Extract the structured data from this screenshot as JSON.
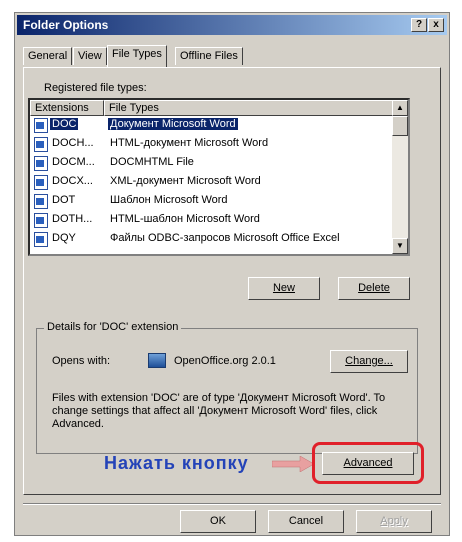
{
  "window": {
    "title": "Folder Options",
    "help_button": "?",
    "close_button": "x"
  },
  "tabs": [
    {
      "label": "General"
    },
    {
      "label": "View"
    },
    {
      "label": "File Types"
    },
    {
      "label": "Offline Files"
    }
  ],
  "registered": {
    "label": "Registered file types:",
    "columns": [
      "Extensions",
      "File Types"
    ],
    "rows": [
      {
        "ext": "DOC",
        "type": "Документ Microsoft Word"
      },
      {
        "ext": "DOCH...",
        "type": "HTML-документ Microsoft Word"
      },
      {
        "ext": "DOCM...",
        "type": "DOCMHTML File"
      },
      {
        "ext": "DOCX...",
        "type": "XML-документ Microsoft Word"
      },
      {
        "ext": "DOT",
        "type": "Шаблон Microsoft Word"
      },
      {
        "ext": "DOTH...",
        "type": "HTML-шаблон Microsoft Word"
      },
      {
        "ext": "DQY",
        "type": "Файлы ODBC-запросов Microsoft Office Excel"
      }
    ],
    "selected_index": 0
  },
  "buttons": {
    "new": "New",
    "delete": "Delete",
    "change": "Change...",
    "advanced": "Advanced",
    "ok": "OK",
    "cancel": "Cancel",
    "apply": "Apply"
  },
  "details": {
    "title": "Details for 'DOC' extension",
    "opens_with_label": "Opens with:",
    "opens_with_app": "OpenOffice.org 2.0.1",
    "description": "Files with extension 'DOC' are of type 'Документ Microsoft Word'. To change settings that affect all 'Документ Microsoft Word' files, click Advanced."
  },
  "annotation": {
    "text": "Нажать кнопку",
    "color": "#2443b8",
    "highlight_color": "#e0202a"
  }
}
